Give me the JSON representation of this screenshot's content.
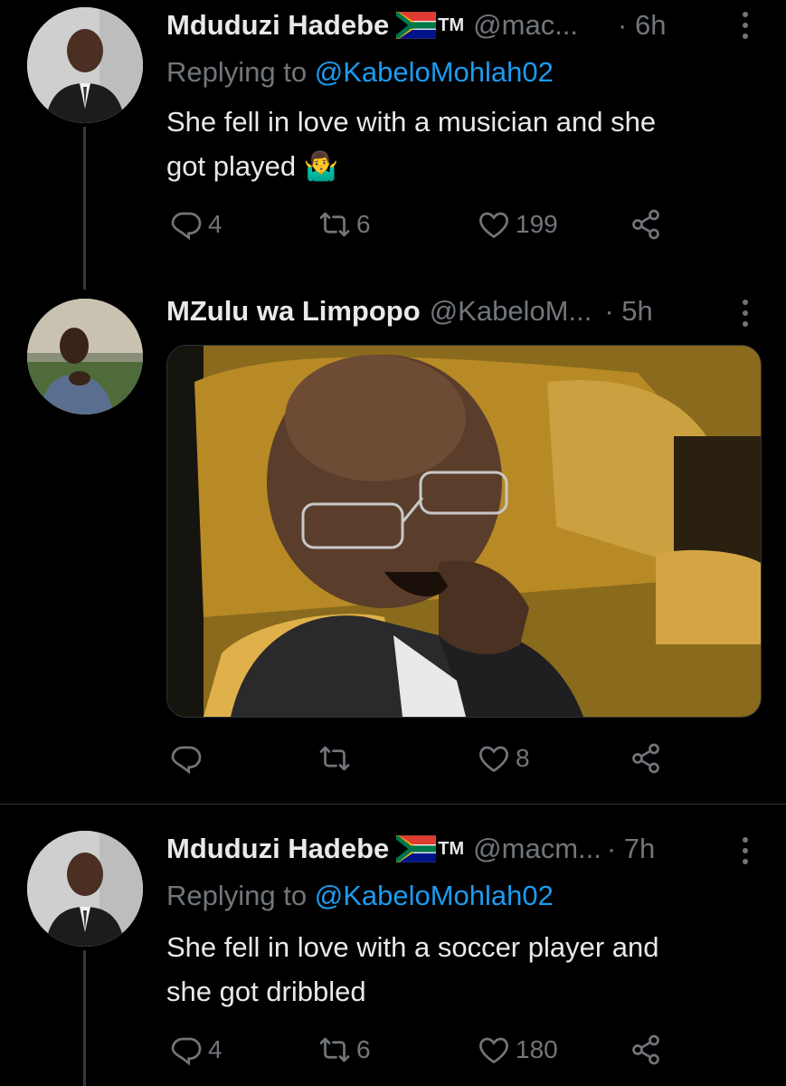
{
  "tweets": [
    {
      "name": "Mduduzi Hadebe",
      "flag": "south-africa-flag",
      "tm": "TM",
      "handle": "@mac...",
      "time": "· 6h",
      "replying_prefix": "Replying to",
      "replying_to": "@KabeloMohlah02",
      "text_line1": "She fell in love with a musician and she",
      "text_line2": "got played 🤷‍♂️",
      "replies": "4",
      "retweets": "6",
      "likes": "199"
    },
    {
      "name": "MZulu wa Limpopo",
      "handle": "@KabeloM...",
      "time": "· 5h",
      "media": "photo-man-laughing-in-parliament",
      "replies": "",
      "retweets": "",
      "likes": "8"
    },
    {
      "name": "Mduduzi Hadebe",
      "flag": "south-africa-flag",
      "tm": "TM",
      "handle": "@macm...",
      "time": "· 7h",
      "replying_prefix": "Replying to",
      "replying_to": "@KabeloMohlah02",
      "text_line1": "She fell in love with a soccer player and",
      "text_line2": "she got dribbled",
      "replies": "4",
      "retweets": "6",
      "likes": "180"
    }
  ],
  "colors": {
    "background": "#000000",
    "muted": "#71767b",
    "link": "#1d9bf0",
    "text": "#e7e9ea"
  }
}
